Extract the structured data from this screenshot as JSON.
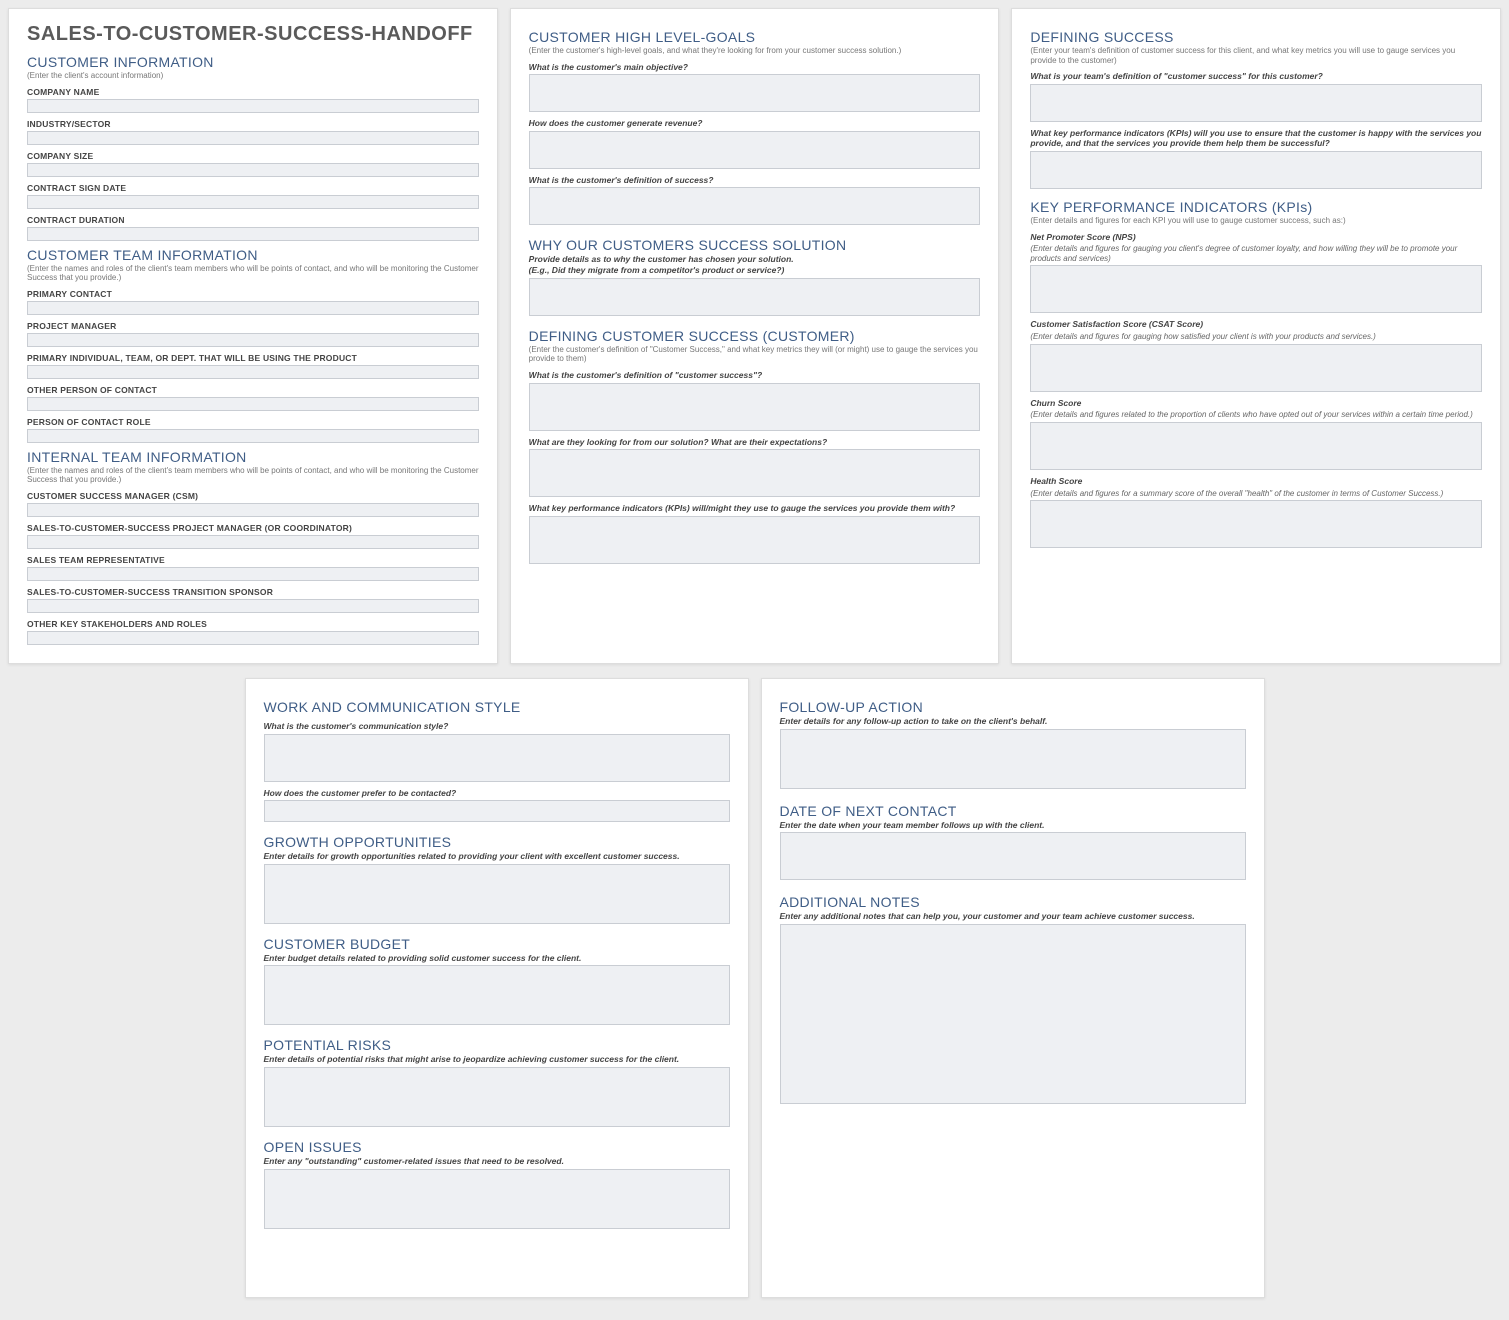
{
  "doc_title": "SALES-TO-CUSTOMER-SUCCESS-HANDOFF",
  "card1": {
    "s1": {
      "title": "CUSTOMER INFORMATION",
      "sub": "(Enter the client's account information)",
      "fields": [
        "COMPANY NAME",
        "INDUSTRY/SECTOR",
        "COMPANY SIZE",
        "CONTRACT SIGN DATE",
        "CONTRACT DURATION"
      ]
    },
    "s2": {
      "title": "CUSTOMER TEAM INFORMATION",
      "sub": "(Enter the names and roles of the client's team members who will be points of contact, and who will be monitoring the Customer Success that you provide.)",
      "fields": [
        "PRIMARY CONTACT",
        "PROJECT MANAGER",
        "PRIMARY INDIVIDUAL, TEAM, OR DEPT. THAT WILL BE USING THE PRODUCT",
        "OTHER PERSON OF CONTACT",
        "PERSON OF CONTACT ROLE"
      ]
    },
    "s3": {
      "title": "INTERNAL TEAM INFORMATION",
      "sub": "(Enter the names and roles of the client's team members who will be points of contact, and who will be monitoring the Customer Success that you provide.)",
      "fields": [
        "CUSTOMER SUCCESS MANAGER (CSM)",
        "SALES-TO-CUSTOMER-SUCCESS PROJECT MANAGER (OR COORDINATOR)",
        "SALES TEAM REPRESENTATIVE",
        "SALES-TO-CUSTOMER-SUCCESS TRANSITION SPONSOR",
        "OTHER KEY STAKEHOLDERS AND ROLES"
      ]
    }
  },
  "card2": {
    "s1": {
      "title": "CUSTOMER HIGH LEVEL-GOALS",
      "sub": "(Enter the customer's high-level goals, and what they're looking for from your customer success solution.)",
      "q1": "What is the customer's main objective?",
      "q2": "How does the customer generate revenue?",
      "q3": "What is the customer's definition of success?"
    },
    "s2": {
      "title": "WHY OUR CUSTOMERS SUCCESS SOLUTION",
      "q1a": "Provide details as to why the customer has chosen your solution.",
      "q1b": "(E.g., Did they migrate from a competitor's product or service?)"
    },
    "s3": {
      "title": "DEFINING CUSTOMER SUCCESS (CUSTOMER)",
      "sub": "(Enter the customer's definition of \"Customer Success,\" and what key metrics they will (or might) use to gauge the services you provide to them)",
      "q1": "What is the customer's definition of \"customer success\"?",
      "q2": "What are they looking for from our solution? What are their expectations?",
      "q3": "What key performance indicators (KPIs) will/might they use to gauge the services you provide them with?"
    }
  },
  "card3": {
    "s1": {
      "title": "DEFINING SUCCESS",
      "sub": "(Enter your team's definition of customer success for this client, and what key metrics you will use to gauge services you provide to the customer)",
      "q1": "What is your team's definition of \"customer success\" for this customer?",
      "q2": "What key performance indicators (KPIs) will you use to ensure that the customer is happy with the services you provide, and that the services you provide them help them be successful?"
    },
    "s2": {
      "title": "KEY PERFORMANCE INDICATORS (KPIs)",
      "sub": "(Enter details and figures for each KPI you will use to gauge customer success, such as:)",
      "k1t": "Net Promoter Score (NPS)",
      "k1d": "(Enter details and figures for gauging you client's degree of customer loyalty, and how willing they will be to promote your products and services)",
      "k2t": "Customer Satisfaction Score (CSAT Score)",
      "k2d": "(Enter details and figures for gauging how satisfied your client is with your products and services.)",
      "k3t": "Churn Score",
      "k3d": "(Enter details and figures related to the proportion of clients who have opted out of your services within a certain time period.)",
      "k4t": "Health Score",
      "k4d": "(Enter details and figures for a summary score of the overall \"health\" of the customer in terms of Customer Success.)"
    }
  },
  "card4": {
    "s1": {
      "title": "WORK AND COMMUNICATION STYLE",
      "q1": "What is the customer's communication style?",
      "q2": "How does the customer prefer to be contacted?"
    },
    "s2": {
      "title": "GROWTH OPPORTUNITIES",
      "q1": "Enter details for growth opportunities related to providing your client with excellent customer success."
    },
    "s3": {
      "title": "CUSTOMER BUDGET",
      "q1": "Enter budget details related to providing solid customer success for the client."
    },
    "s4": {
      "title": "POTENTIAL RISKS",
      "q1": "Enter details of potential risks that might arise to jeopardize achieving customer success for the client."
    },
    "s5": {
      "title": "OPEN ISSUES",
      "q1": "Enter any \"outstanding\" customer-related issues that need to be resolved."
    }
  },
  "card5": {
    "s1": {
      "title": "FOLLOW-UP ACTION",
      "q1": "Enter details for any follow-up action to take on the client's behalf."
    },
    "s2": {
      "title": "DATE OF NEXT CONTACT",
      "q1": "Enter the date when your team member follows up with the client."
    },
    "s3": {
      "title": "ADDITIONAL NOTES",
      "q1": "Enter any additional notes that can help you, your customer and your team achieve customer success."
    }
  }
}
